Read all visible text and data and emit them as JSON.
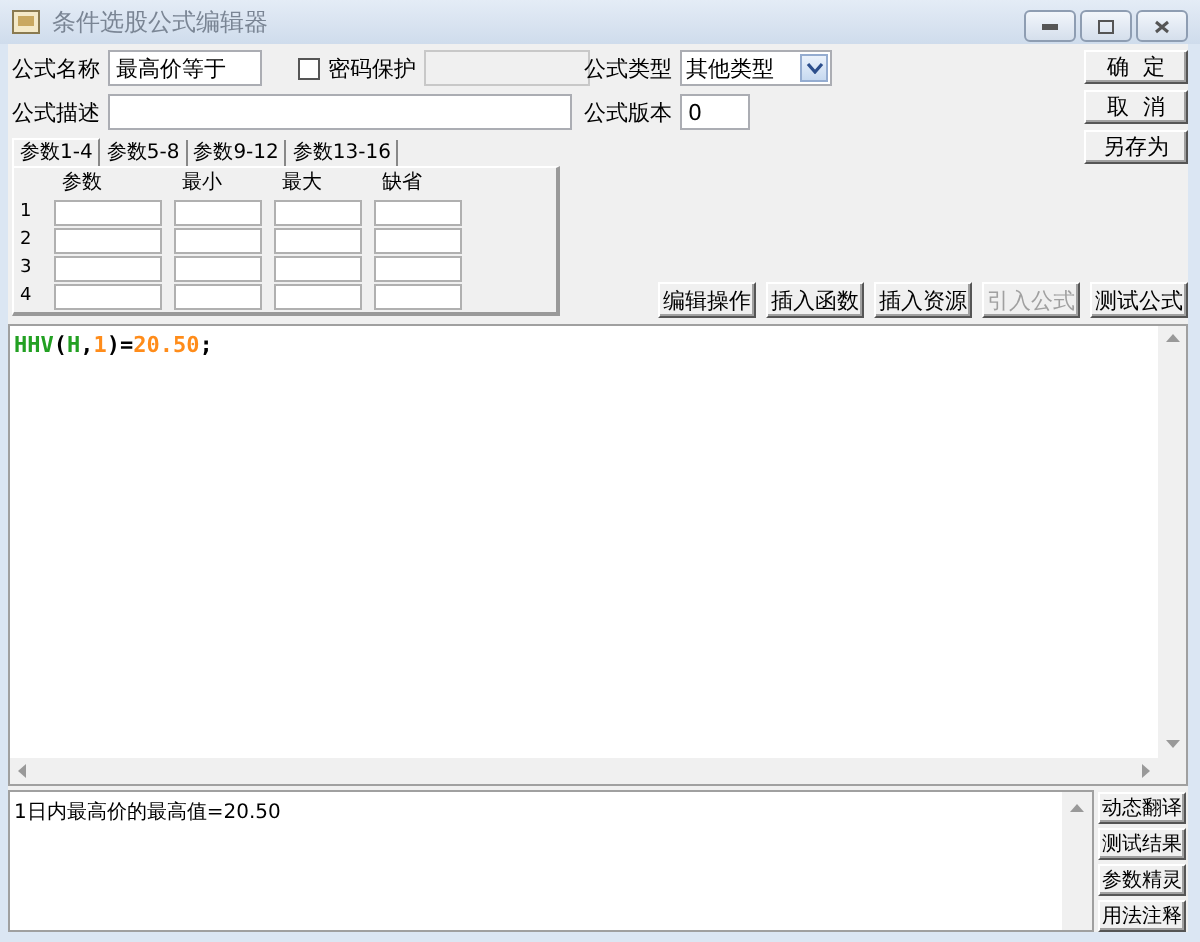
{
  "window": {
    "title": "条件选股公式编辑器"
  },
  "form": {
    "name_label": "公式名称",
    "name_value": "最高价等于",
    "password_label": "密码保护",
    "password_checked": false,
    "description_label": "公式描述",
    "type_label": "公式类型",
    "type_value": "其他类型",
    "version_label": "公式版本",
    "version_value": "0"
  },
  "tabs": [
    {
      "label": "参数1-4",
      "selected": true
    },
    {
      "label": "参数5-8",
      "selected": false
    },
    {
      "label": "参数9-12",
      "selected": false
    },
    {
      "label": "参数13-16",
      "selected": false
    }
  ],
  "param_columns": [
    "参数",
    "最小",
    "最大",
    "缺省"
  ],
  "param_rows": [
    "1",
    "2",
    "3",
    "4"
  ],
  "side_buttons": [
    {
      "label": "确  定"
    },
    {
      "label": "取  消"
    },
    {
      "label": "另存为"
    }
  ],
  "toolbar": [
    {
      "label": "编辑操作",
      "disabled": false
    },
    {
      "label": "插入函数",
      "disabled": false
    },
    {
      "label": "插入资源",
      "disabled": false
    },
    {
      "label": "引入公式",
      "disabled": true
    },
    {
      "label": "测试公式",
      "disabled": false
    }
  ],
  "code": [
    {
      "text": "HHV",
      "kind": "name"
    },
    {
      "text": "(",
      "kind": "op"
    },
    {
      "text": "H",
      "kind": "name"
    },
    {
      "text": ",",
      "kind": "op"
    },
    {
      "text": "1",
      "kind": "number"
    },
    {
      "text": ")=",
      "kind": "op"
    },
    {
      "text": "20.50",
      "kind": "number"
    },
    {
      "text": ";",
      "kind": "op"
    }
  ],
  "output": {
    "text": "1日内最高价的最高值=20.50"
  },
  "output_buttons": [
    {
      "label": "动态翻译"
    },
    {
      "label": "测试结果"
    },
    {
      "label": "参数精灵"
    },
    {
      "label": "用法注释"
    }
  ]
}
